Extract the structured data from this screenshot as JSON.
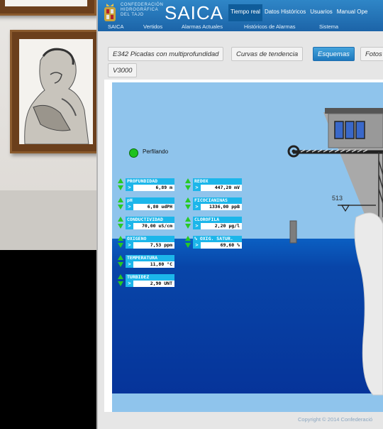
{
  "header": {
    "org_lines": [
      "CONFEDERACIÓN",
      "HIDROGRÁFICA",
      "DEL TAJO"
    ],
    "app_name": "SAICA",
    "top_nav": [
      "Tiempo real",
      "Datos Históricos",
      "Usuarios",
      "Manual Ope"
    ],
    "sub_nav": [
      "SAICA",
      "Vertidos",
      "Alarmas Actuales",
      "Históricos de Alarmas",
      "Sistema"
    ]
  },
  "tabs": [
    {
      "label": "E342 Picadas con multiprofundidad",
      "active": false
    },
    {
      "label": "Curvas de tendencia",
      "active": false
    },
    {
      "label": "Esquemas",
      "active": true
    },
    {
      "label": "Fotos",
      "active": false
    },
    {
      "label": "V3000",
      "active": false
    }
  ],
  "status": {
    "profiling_label": "Perfilando",
    "profiling_color": "#1ec21e"
  },
  "sensors_left": [
    {
      "name": "PROFUNDIDAD",
      "value": "6,89 m"
    },
    {
      "name": "pH",
      "value": "6,80 udPH"
    },
    {
      "name": "CONDUCTIVIDAD",
      "value": "70,00 uS/cm"
    },
    {
      "name": "OXIGENO",
      "value": "7,53 ppm"
    },
    {
      "name": "TEMPERATURA",
      "value": "11,80 °C"
    },
    {
      "name": "TURBIDEZ",
      "value": "2,90 UNT"
    }
  ],
  "sensors_right": [
    {
      "name": "REDOX",
      "value": "447,20 mV"
    },
    {
      "name": "FICOCIANINAS",
      "value": "1336,00 ppB"
    },
    {
      "name": "CLOROFILA",
      "value": "2,20 µg/l"
    },
    {
      "name": "% OXIG. SATUR.",
      "value": "69,60 %"
    }
  ],
  "scene": {
    "level_label": "513",
    "sky_color": "#8fc4ec",
    "water_color": "#0845a8"
  },
  "footer": {
    "copyright": "Copyright © 2014 Confederació"
  }
}
